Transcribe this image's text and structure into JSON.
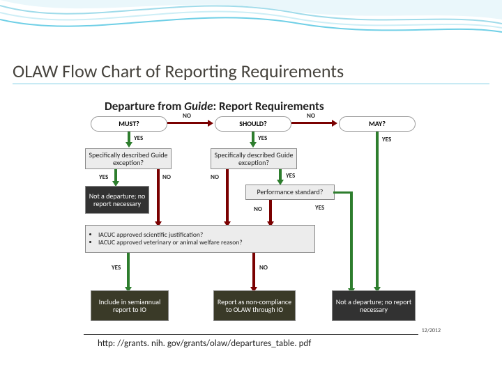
{
  "slide_title": "OLAW Flow Chart of Reporting Requirements",
  "diagram_title": "Departure from ",
  "diagram_title_guide": "Guide",
  "diagram_title_suffix": ": Report Requirements",
  "nodes": {
    "must": "MUST?",
    "should": "SHOULD?",
    "may": "MAY?",
    "spec1": "Specifically described Guide exception?",
    "spec2": "Specifically described Guide exception?",
    "not1": "Not a departure; no report necessary",
    "perf": "Performance standard?",
    "iacuc1": "IACUC approved scientific justification?",
    "iacuc2": "IACUC approved veterinary or animal welfare reason?",
    "include": "Include in semiannual report to IO",
    "report": "Report as non-compliance to OLAW through IO",
    "not2": "Not a departure; no report necessary"
  },
  "labels": {
    "yes": "YES",
    "no": "NO"
  },
  "footer_url": "http: //grants. nih. gov/grants/olaw/departures_table. pdf",
  "date_stamp": "12/2012"
}
